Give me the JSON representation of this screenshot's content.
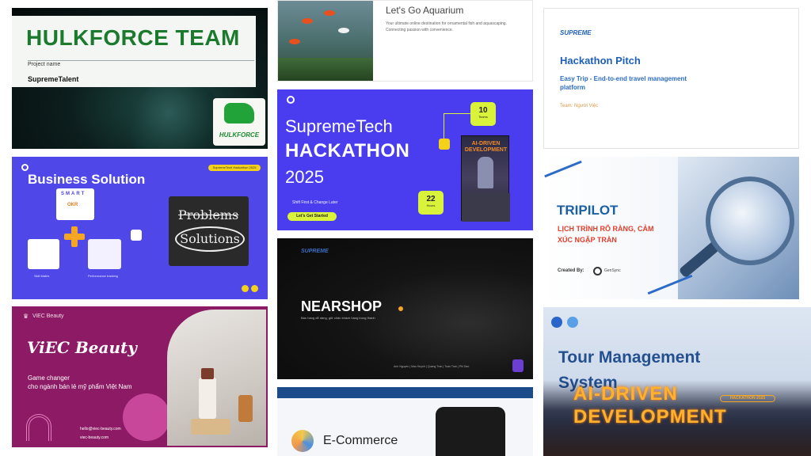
{
  "hulkforce": {
    "title": "HULKFORCE TEAM",
    "project_label": "Project name",
    "project_value": "SupremeTalent",
    "logo_text": "HULKFORCE"
  },
  "business": {
    "title": "Business Solution",
    "header_pill": "SupremeTech Hackathon 2025",
    "board_top": "Problems",
    "board_bottom": "Solutions",
    "smart_label": "SMART",
    "okr_label": "OKR",
    "labels": [
      "Skill Matrix",
      "Performance tracking"
    ]
  },
  "viec": {
    "brand": "ViEC Beauty",
    "title": "ViEC Beauty",
    "sub1": "Game changer",
    "sub2": "cho ngành bán lẻ mỹ phẩm Việt Nam",
    "contact1": "hello@viec-beauty.com",
    "contact2": "viec-beauty.com"
  },
  "aquarium": {
    "title": "Let's Go Aquarium",
    "desc1": "Your ultimate online destination for ornamental fish and aquascaping.",
    "desc2": "Connecting passion with convenience."
  },
  "hackathon": {
    "line1": "SupremeTech",
    "line2": "HACKATHON",
    "line3": "2025",
    "tagline": "Shift First & Change Later",
    "button": "Let's Get Started",
    "teams_value": "10",
    "teams_label": "Teams",
    "hours_value": "22",
    "hours_label": "Hours",
    "poster_title": "AI-DRIVEN DEVELOPMENT"
  },
  "nearshop": {
    "brand": "SUPREME",
    "title": "NEARSHOP",
    "subtitle": "Bán hàng dễ dàng, giữ chân khách hàng trung thành",
    "members": "Anh Nguyen | Mau Huynh | Quang Tran | Tuan Tran | Phi Dao"
  },
  "ecommerce": {
    "title": "E-Commerce"
  },
  "pitch": {
    "logo": "SUPREME",
    "title": "Hackathon Pitch",
    "desc1": "Easy Trip - End-to-end travel management",
    "desc2": "platform",
    "team": "Team: Người Việc"
  },
  "tripilot": {
    "title": "TRIPILOT",
    "sub1": "LỊCH TRÌNH RÕ RÀNG, CẢM",
    "sub2": "XÚC NGẬP TRÀN",
    "created_by": "Created By:",
    "creator": "GenSync"
  },
  "tour": {
    "line1": "Tour Management",
    "line2": "System",
    "ai_line1": "AI-DRIVEN",
    "ai_line2": "DEVELOPMENT",
    "badge": "HACKATHON 2025"
  },
  "colors": {
    "hulk_green": "#1b7a2e",
    "business_bg": "#5047e8",
    "viec_bg": "#8c1a64",
    "hackathon_bg": "#4a3df0",
    "accent_yellow": "#d9f23a",
    "pitch_blue": "#1e5fb8",
    "tripilot_red": "#e23d2a",
    "ai_orange": "#ffb12e"
  }
}
